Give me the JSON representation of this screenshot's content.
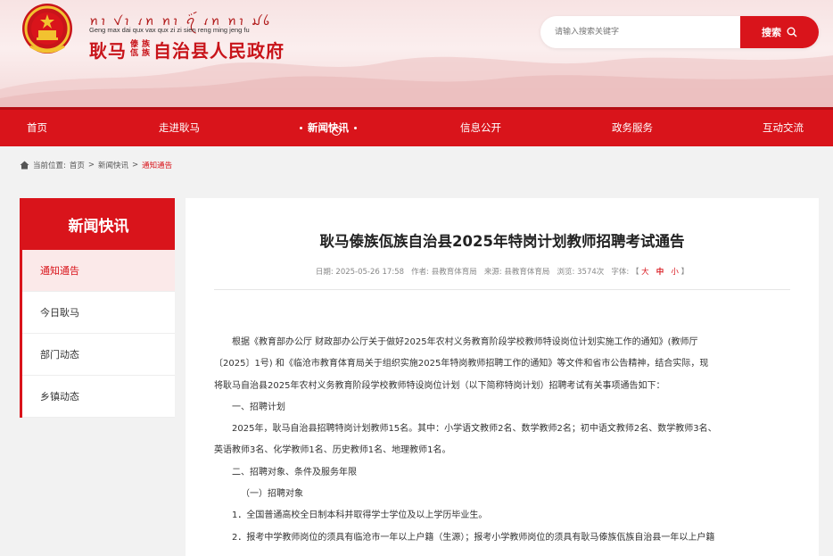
{
  "header": {
    "script_text": "ꪀꪱ ꪚꪱ ꪹꪀ ꪀꪱ ꪖꪾ ꪹꪀ ꪀꪱ ꪣꪉ",
    "pinyin": "Geng max dai qux vax qux zi zi sien reng ming jeng fu",
    "name_part1": "耿马",
    "name_stack1": [
      "傣",
      "佤"
    ],
    "name_stack2": [
      "族",
      "族"
    ],
    "name_part2": "自治县人民政府",
    "search": {
      "placeholder": "请输入搜索关键字",
      "button_label": "搜索"
    }
  },
  "nav": {
    "items": [
      "首页",
      "走进耿马",
      "新闻快讯",
      "信息公开",
      "政务服务",
      "互动交流"
    ],
    "active": "新闻快讯"
  },
  "breadcrumb": {
    "prefix": "当前位置:",
    "items": [
      "首页",
      "新闻快讯",
      "通知通告"
    ],
    "separator": ">"
  },
  "sidebar": {
    "title": "新闻快讯",
    "items": [
      "通知通告",
      "今日耿马",
      "部门动态",
      "乡镇动态"
    ]
  },
  "article": {
    "title": "耿马傣族佤族自治县2025年特岗计划教师招聘考试通告",
    "meta": {
      "date_label": "日期:",
      "date": "2025-05-26 17:58",
      "author_label": "作者:",
      "author": "县教育体育局",
      "source_label": "来源:",
      "source": "县教育体育局",
      "views_label": "浏览:",
      "views": "3574次",
      "font_label": "字体:",
      "font_open": "【",
      "font_large": "大",
      "font_medium": "中",
      "font_small": "小",
      "font_close": "】"
    },
    "paragraphs": [
      "根据《教育部办公厅 财政部办公厅关于做好2025年农村义务教育阶段学校教师特设岗位计划实施工作的通知》(教师厅",
      "〔2025〕1号) 和《临沧市教育体育局关于组织实施2025年特岗教师招聘工作的通知》等文件和省市公告精神，结合实际，现",
      "将耿马自治县2025年农村义务教育阶段学校教师特设岗位计划（以下简称特岗计划）招聘考试有关事项通告如下：",
      "一、招聘计划",
      "2025年，耿马自治县招聘特岗计划教师15名。其中：小学语文教师2名、数学教师2名；初中语文教师2名、数学教师3名、",
      "英语教师3名、化学教师1名、历史教师1名、地理教师1名。",
      "二、招聘对象、条件及服务年限",
      "（一）招聘对象",
      "1．全国普通高校全日制本科并取得学士学位及以上学历毕业生。",
      "2．报考中学教师岗位的须具有临沧市一年以上户籍（生源）；报考小学教师岗位的须具有耿马傣族佤族自治县一年以上户籍"
    ]
  }
}
